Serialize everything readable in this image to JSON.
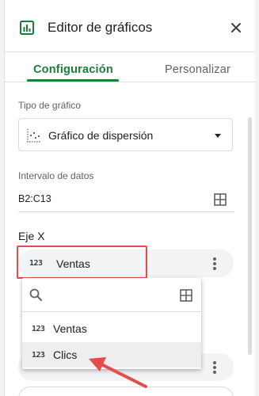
{
  "header": {
    "title": "Editor de gráficos"
  },
  "tabs": [
    {
      "label": "Configuración",
      "active": true
    },
    {
      "label": "Personalizar",
      "active": false
    }
  ],
  "chart_type": {
    "label": "Tipo de gráfico",
    "value": "Gráfico de dispersión"
  },
  "data_range": {
    "label": "Intervalo de datos",
    "value": "B2:C13"
  },
  "x_axis": {
    "label": "Eje X",
    "chip_type": "123",
    "value": "Ventas"
  },
  "dropdown": {
    "options": [
      {
        "type": "123",
        "label": "Ventas"
      },
      {
        "type": "123",
        "label": "Clics"
      }
    ]
  },
  "colors": {
    "accent": "#188038",
    "highlight": "#e74c4c"
  }
}
